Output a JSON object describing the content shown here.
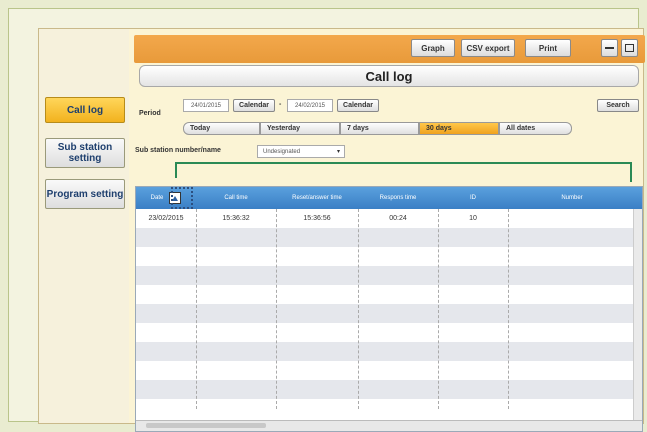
{
  "toolbar": {
    "graph_label": "Graph",
    "csv_label": "CSV export",
    "print_label": "Print"
  },
  "page_title": "Call log",
  "nav": {
    "call_log": "Call log",
    "sub_station": "Sub station setting",
    "program": "Program setting"
  },
  "period": {
    "label": "Period",
    "from_date": "24/01/2015",
    "to_date": "24/02/2015",
    "dash": "-",
    "calendar_label": "Calendar",
    "search_label": "Search",
    "options": [
      "Today",
      "Yesterday",
      "7 days",
      "30 days",
      "All dates"
    ],
    "selected": "30 days"
  },
  "sub_station": {
    "label": "Sub station number/name",
    "selected": "Undesignated"
  },
  "table": {
    "headers": [
      "Date",
      "Call time",
      "Reset/answer time",
      "Respons time",
      "ID",
      "Number"
    ],
    "sort_icon": "triangle-up-icon",
    "rows": [
      [
        "23/02/2015",
        "15:36:32",
        "15:36:56",
        "00:24",
        "10",
        ""
      ]
    ]
  },
  "colors": {
    "accent": "#f0a21e",
    "header": "#3a7fc5",
    "highlight_line": "#2a8a55"
  }
}
